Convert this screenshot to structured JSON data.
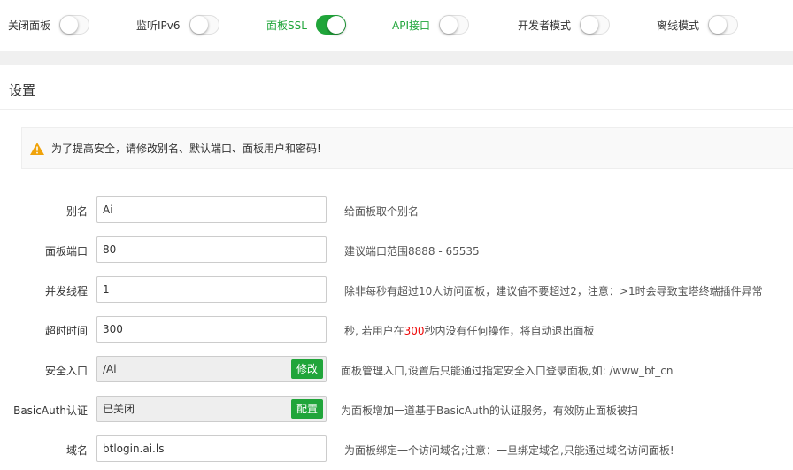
{
  "toggles": [
    {
      "label": "关闭面板",
      "state": "off",
      "label_color": "#333333"
    },
    {
      "label": "监听IPv6",
      "state": "off",
      "label_color": "#333333"
    },
    {
      "label": "面板SSL",
      "state": "on",
      "label_color": "#20a53a"
    },
    {
      "label": "API接口",
      "state": "off",
      "label_color": "#20a53a"
    },
    {
      "label": "开发者模式",
      "state": "off",
      "label_color": "#333333"
    },
    {
      "label": "离线模式",
      "state": "off",
      "label_color": "#333333"
    }
  ],
  "panel": {
    "title": "设置"
  },
  "warning": {
    "icon": "warning-triangle-icon",
    "text": "为了提高安全，请修改别名、默认端口、面板用户和密码!"
  },
  "fields": {
    "alias": {
      "label": "别名",
      "value": "Ai",
      "help": "给面板取个别名"
    },
    "port": {
      "label": "面板端口",
      "value": "80",
      "help": "建议端口范围8888 - 65535"
    },
    "threads": {
      "label": "并发线程",
      "value": "1",
      "help": "除非每秒有超过10人访问面板，建议值不要超过2，注意：>1时会导致宝塔终端插件异常"
    },
    "timeout": {
      "label": "超时时间",
      "value": "300",
      "help_prefix": "秒, 若用户在",
      "help_highlight": "300",
      "help_suffix": "秒内没有任何操作，将自动退出面板"
    },
    "entry": {
      "label": "安全入口",
      "value": "/Ai",
      "button": "修改",
      "help": "面板管理入口,设置后只能通过指定安全入口登录面板,如: /www_bt_cn"
    },
    "basicauth": {
      "label": "BasicAuth认证",
      "value": "已关闭",
      "button": "配置",
      "help": "为面板增加一道基于BasicAuth的认证服务，有效防止面板被扫"
    },
    "domain": {
      "label": "域名",
      "value": "btlogin.ai.ls",
      "help": "为面板绑定一个访问域名;注意：一旦绑定域名,只能通过域名访问面板!"
    }
  },
  "colors": {
    "accent": "#20a53a",
    "highlight": "#ef0808",
    "warning": "#f0a30a"
  }
}
